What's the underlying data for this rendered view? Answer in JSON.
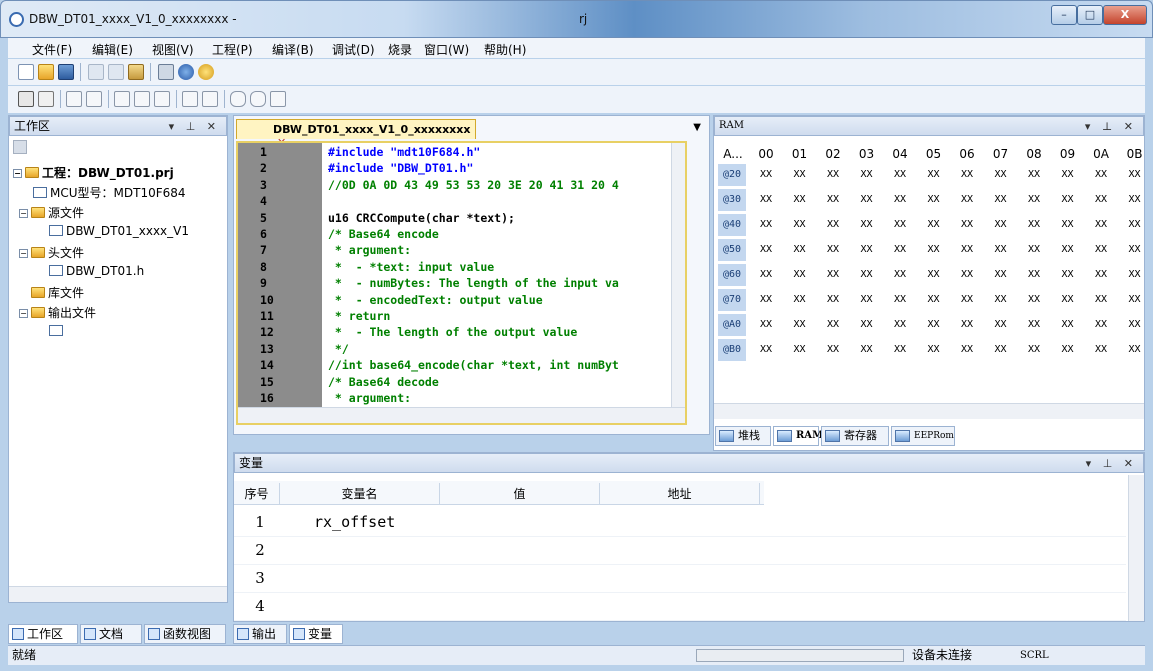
{
  "window": {
    "title": "DBW_DT01_xxxx_V1_0_xxxxxxxx -",
    "title_suffix": "rj",
    "buttons": {
      "minimize": "–",
      "maximize": "□",
      "close": "X"
    }
  },
  "menu": [
    "文件(F)",
    "编辑(E)",
    "视图(V)",
    "工程(P)",
    "编译(B)",
    "调试(D)",
    "烧录",
    "窗口(W)",
    "帮助(H)"
  ],
  "toolbar1_icons": [
    "new-file-icon",
    "open-folder-icon",
    "save-icon",
    "cut-icon",
    "copy-icon",
    "paste-icon",
    "print-icon",
    "help-icon",
    "user-icon"
  ],
  "toolbar2_icons": [
    "memory-icon",
    "chip-icon",
    "step-icon",
    "step-into-icon",
    "step-over-icon",
    "step-out-icon",
    "reset-icon",
    "run-to-cursor-icon",
    "hand-icon",
    "stop-hand-icon",
    "rst-icon"
  ],
  "workspace": {
    "title": "工作区",
    "tree": [
      {
        "label": "工程：DBW_DT01.prj",
        "level": 0,
        "icon": "folder"
      },
      {
        "label": "MCU型号：MDT10F684",
        "level": 1,
        "icon": "chip"
      },
      {
        "label": "源文件",
        "level": 1,
        "icon": "folder"
      },
      {
        "label": "DBW_DT01_xxxx_V1",
        "level": 2,
        "icon": "c-file"
      },
      {
        "label": "头文件",
        "level": 1,
        "icon": "folder"
      },
      {
        "label": "DBW_DT01.h",
        "level": 2,
        "icon": "h-file"
      },
      {
        "label": "库文件",
        "level": 1,
        "icon": "folder"
      },
      {
        "label": "输出文件",
        "level": 1,
        "icon": "folder"
      },
      {
        "label": "",
        "level": 2,
        "icon": "output-file"
      }
    ],
    "tabs": [
      "工作区",
      "文档",
      "函数视图"
    ]
  },
  "editor": {
    "tab": "DBW_DT01_xxxx_V1_0_xxxxxxxx",
    "lines": [
      {
        "n": "1",
        "text": "#include \"mdt10F684.h\"",
        "color": "#0000ff"
      },
      {
        "n": "2",
        "text": "#include \"DBW_DT01.h\"",
        "color": "#0000ff"
      },
      {
        "n": "3",
        "text": "//0D 0A 0D 43 49 53 53 20 3E 20 41 31 20 4",
        "color": "#008000"
      },
      {
        "n": "4",
        "text": "",
        "color": "#000000"
      },
      {
        "n": "5",
        "text": "u16 CRCCompute(char *text);",
        "color": "#000000"
      },
      {
        "n": "6",
        "text": "/* Base64 encode",
        "color": "#008000"
      },
      {
        "n": "7",
        "text": " * argument:",
        "color": "#008000"
      },
      {
        "n": "8",
        "text": " *  - *text: input value",
        "color": "#008000"
      },
      {
        "n": "9",
        "text": " *  - numBytes: The length of the input va",
        "color": "#008000"
      },
      {
        "n": "10",
        "text": " *  - encodedText: output value",
        "color": "#008000"
      },
      {
        "n": "11",
        "text": " * return",
        "color": "#008000"
      },
      {
        "n": "12",
        "text": " *  - The length of the output value",
        "color": "#008000"
      },
      {
        "n": "13",
        "text": " */",
        "color": "#008000"
      },
      {
        "n": "14",
        "text": "//int base64_encode(char *text, int numByt",
        "color": "#008000"
      },
      {
        "n": "15",
        "text": "/* Base64 decode",
        "color": "#008000"
      },
      {
        "n": "16",
        "text": " * argument:",
        "color": "#008000"
      }
    ]
  },
  "ram": {
    "title": "RAM",
    "col_header_first": "A...",
    "columns": [
      "00",
      "01",
      "02",
      "03",
      "04",
      "05",
      "06",
      "07",
      "08",
      "09",
      "0A",
      "0B"
    ],
    "rows": [
      "@20",
      "@30",
      "@40",
      "@50",
      "@60",
      "@70",
      "@A0",
      "@B0"
    ],
    "cell_value": "XX",
    "tabs": [
      "堆栈",
      "RAM",
      "寄存器",
      "EEPRom"
    ]
  },
  "variables": {
    "title": "变量",
    "headers": [
      "序号",
      "变量名",
      "值",
      "地址"
    ],
    "rows": [
      {
        "idx": "1",
        "name": "rx_offset"
      },
      {
        "idx": "2",
        "name": ""
      },
      {
        "idx": "3",
        "name": ""
      },
      {
        "idx": "4",
        "name": ""
      }
    ],
    "tabs": [
      "输出",
      "变量"
    ]
  },
  "status": {
    "left": "就绪",
    "device": "设备未连接",
    "scrl": "SCRL"
  }
}
